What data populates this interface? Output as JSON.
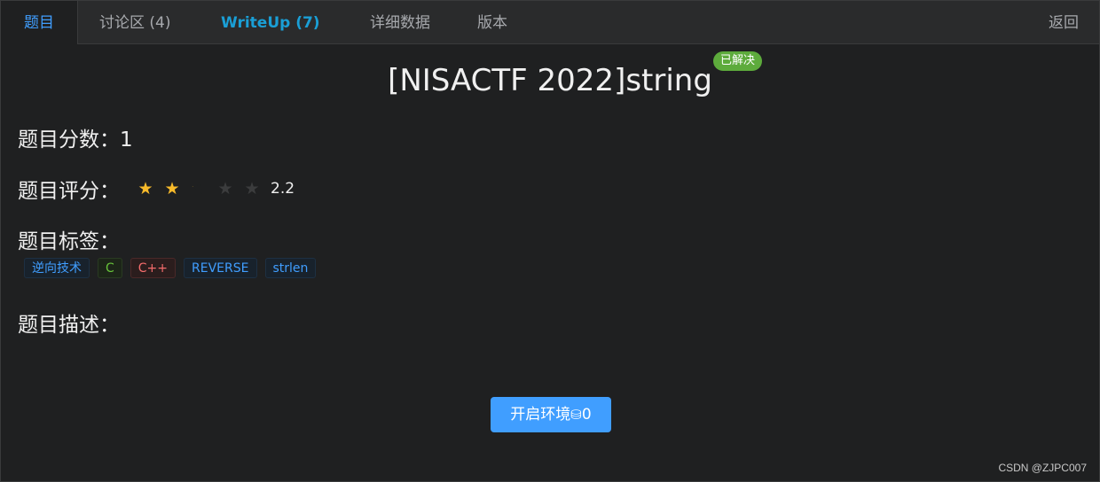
{
  "tabs": {
    "problem": "题目",
    "discuss": "讨论区 (4)",
    "writeup": "WriteUp (7)",
    "detail": "详细数据",
    "version": "版本",
    "back": "返回"
  },
  "challenge": {
    "title": "[NISACTF 2022]string",
    "solved_badge": "已解决",
    "score_label": "题目分数：",
    "score_value": "1",
    "rating_label": "题目评分：",
    "rating_value": "2.2",
    "rating": 2.2,
    "rating_max": 5,
    "tags_label": "题目标签：",
    "tags": [
      {
        "text": "逆向技术",
        "color": "blue"
      },
      {
        "text": "C",
        "color": "green"
      },
      {
        "text": "C++",
        "color": "red"
      },
      {
        "text": "REVERSE",
        "color": "blue"
      },
      {
        "text": "strlen",
        "color": "blue"
      }
    ],
    "description_label": "题目描述："
  },
  "actions": {
    "start_env": "开启环境",
    "coin_icon": "coin-icon",
    "coin_symbol": "⛁",
    "cost": "0"
  },
  "watermark": "CSDN @ZJPC007",
  "colors": {
    "accent": "#409eff",
    "writeup": "#1a9fd6",
    "solved": "#5dab3c",
    "star": "#f7ba2a"
  }
}
